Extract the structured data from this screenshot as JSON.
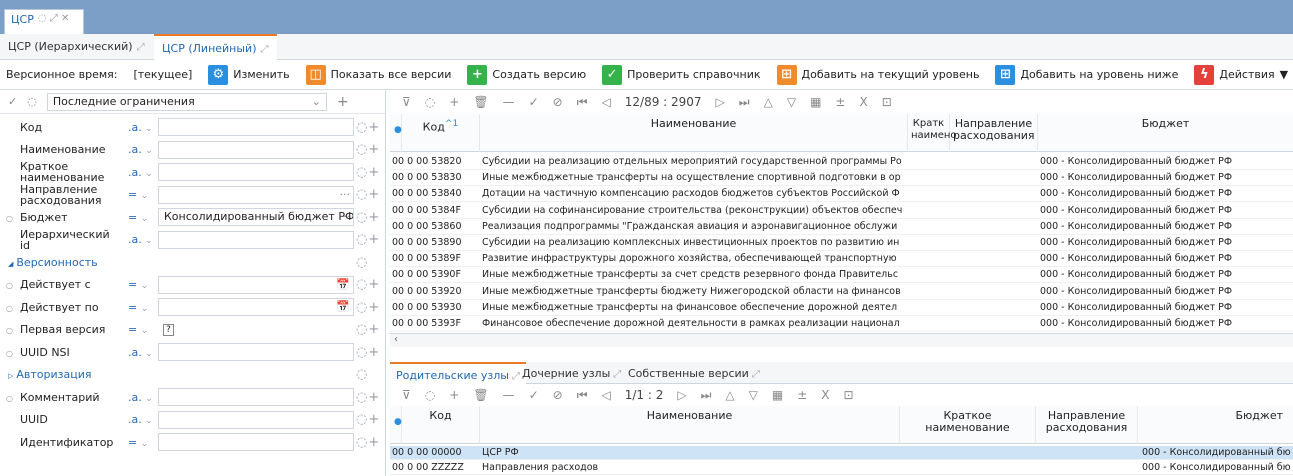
{
  "window": {
    "doc_tab": "ЦСР",
    "doc_tab_icons": "◌ ⤢ ✕"
  },
  "subtabs": [
    {
      "label": "ЦСР (Иерархический)",
      "active": false
    },
    {
      "label": "ЦСР (Линейный)",
      "active": true
    }
  ],
  "toolbar": {
    "version_time_label": "Версионное время:",
    "version_time_value": "[текущее]",
    "change": "Изменить",
    "show_all": "Показать все версии",
    "create": "Создать версию",
    "check": "Проверить справочник",
    "add_current": "Добавить на текущий уровень",
    "add_below": "Добавить на уровень ниже",
    "actions": "Действия"
  },
  "filter": {
    "preset": "Последние ограничения",
    "fields": [
      {
        "label": "Код",
        "op": ".a.",
        "value": ""
      },
      {
        "label": "Наименование",
        "op": ".a.",
        "value": ""
      },
      {
        "label": "Краткое наименование",
        "op": ".a.",
        "value": ""
      },
      {
        "label": "Направление расходования",
        "op": "=",
        "value": "",
        "extra": "···"
      },
      {
        "label": "Бюджет",
        "op": "=",
        "value": "Консолидированный бюджет РФ",
        "extra": "···",
        "dot": true
      },
      {
        "label": "Иерархический id",
        "op": ".a.",
        "value": ""
      }
    ],
    "group_version": "Версионность",
    "version_fields": [
      {
        "label": "Действует с",
        "op": "=",
        "value": "",
        "extra": "📅",
        "dot": true
      },
      {
        "label": "Действует по",
        "op": "=",
        "value": "",
        "extra": "📅",
        "dot": true
      },
      {
        "label": "Первая версия",
        "op": "=",
        "value": "?",
        "dot": true
      },
      {
        "label": "UUID NSI",
        "op": ".a.",
        "value": "",
        "dot": true
      }
    ],
    "group_auth": "Авторизация",
    "auth_fields": [
      {
        "label": "Комментарий",
        "op": ".a.",
        "value": "",
        "dot": true
      },
      {
        "label": "UUID",
        "op": ".a.",
        "value": ""
      },
      {
        "label": "Идентификатор",
        "op": "=",
        "value": ""
      }
    ]
  },
  "grid": {
    "pager": "12/89 : 2907",
    "columns": {
      "code": "Код",
      "name": "Наименование",
      "short": "Кратк наимено",
      "direction": "Направление расходования",
      "budget": "Бюджет"
    },
    "rows": [
      {
        "code": "00 0 00 53820",
        "name": "Субсидии на реализацию отдельных мероприятий государственной программы Ро",
        "budget": "000 - Консолидированный бюджет РФ"
      },
      {
        "code": "00 0 00 53830",
        "name": "Иные межбюджетные трансферты на осуществление спортивной подготовки в ор",
        "budget": "000 - Консолидированный бюджет РФ"
      },
      {
        "code": "00 0 00 53840",
        "name": "Дотации на частичную компенсацию расходов бюджетов субъектов Российской Ф",
        "budget": "000 - Консолидированный бюджет РФ"
      },
      {
        "code": "00 0 00 5384F",
        "name": "Субсидии на софинансирование строительства (реконструкции) объектов обеспеч",
        "budget": "000 - Консолидированный бюджет РФ"
      },
      {
        "code": "00 0 00 53860",
        "name": "Реализация подпрограммы \"Гражданская авиация и аэронавигационное обслужи",
        "budget": "000 - Консолидированный бюджет РФ"
      },
      {
        "code": "00 0 00 53890",
        "name": "Субсидии на реализацию комплексных инвестиционных проектов по развитию ин",
        "budget": "000 - Консолидированный бюджет РФ"
      },
      {
        "code": "00 0 00 5389F",
        "name": "Развитие инфраструктуры дорожного хозяйства, обеспечивающей транспортную",
        "budget": "000 - Консолидированный бюджет РФ"
      },
      {
        "code": "00 0 00 5390F",
        "name": "Иные межбюджетные трансферты за счет средств резервного фонда Правительс",
        "budget": "000 - Консолидированный бюджет РФ"
      },
      {
        "code": "00 0 00 53920",
        "name": "Иные межбюджетные трансферты бюджету Нижегородской области на финансов",
        "budget": "000 - Консолидированный бюджет РФ"
      },
      {
        "code": "00 0 00 53930",
        "name": "Иные межбюджетные трансферты на финансовое обеспечение дорожной деятел",
        "budget": "000 - Консолидированный бюджет РФ"
      },
      {
        "code": "00 0 00 5393F",
        "name": "Финансовое обеспечение дорожной деятельности в рамках реализации национал",
        "budget": "000 - Консолидированный бюджет РФ"
      }
    ]
  },
  "lower": {
    "tabs": [
      {
        "label": "Родительские узлы",
        "active": true
      },
      {
        "label": "Дочерние узлы",
        "active": false
      },
      {
        "label": "Собственные версии",
        "active": false
      }
    ],
    "pager": "1/1 : 2",
    "columns": {
      "code": "Код",
      "name": "Наименование",
      "short": "Краткое наименование",
      "direction": "Направление расходования",
      "budget": "Бюджет"
    },
    "rows": [
      {
        "code": "00 0 00 00000",
        "name": "ЦСР РФ",
        "budget": "000 - Консолидированный бю"
      },
      {
        "code": "00 0 00 ZZZZZ",
        "name": "Направления расходов",
        "budget": "000 - Консолидированный бю"
      }
    ]
  }
}
